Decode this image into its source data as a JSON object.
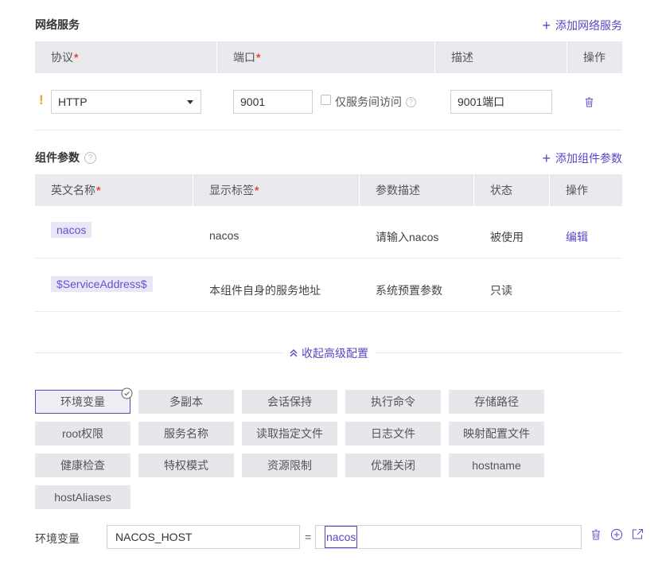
{
  "network": {
    "title": "网络服务",
    "add_label": "添加网络服务",
    "columns": [
      "协议",
      "端口",
      "描述",
      "操作"
    ],
    "row": {
      "warn": "!",
      "protocol": "HTTP",
      "port": "9001",
      "internal_label": "仅服务间访问",
      "desc": "9001端口"
    }
  },
  "component": {
    "title": "组件参数",
    "add_label": "添加组件参数",
    "columns": [
      "英文名称",
      "显示标签",
      "参数描述",
      "状态",
      "操作"
    ],
    "rows": [
      {
        "name": "nacos",
        "label": "nacos",
        "desc": "请输入nacos",
        "status": "被使用",
        "action": "编辑"
      },
      {
        "name": "$ServiceAddress$",
        "label": "本组件自身的服务地址",
        "desc": "系统预置参数",
        "status": "只读",
        "action": ""
      }
    ]
  },
  "advanced": {
    "toggle_label": "收起高级配置",
    "options": [
      "环境变量",
      "多副本",
      "会话保持",
      "执行命令",
      "存储路径",
      "root权限",
      "服务名称",
      "读取指定文件",
      "日志文件",
      "映射配置文件",
      "健康检查",
      "特权模式",
      "资源限制",
      "优雅关闭",
      "hostname",
      "hostAliases"
    ],
    "selected": "环境变量"
  },
  "env": {
    "label": "环境变量",
    "key": "NACOS_HOST",
    "equals": "=",
    "value": "nacos"
  },
  "colors": {
    "accent": "#5b45c2",
    "required": "#e6472a",
    "warning": "#f0a020"
  }
}
